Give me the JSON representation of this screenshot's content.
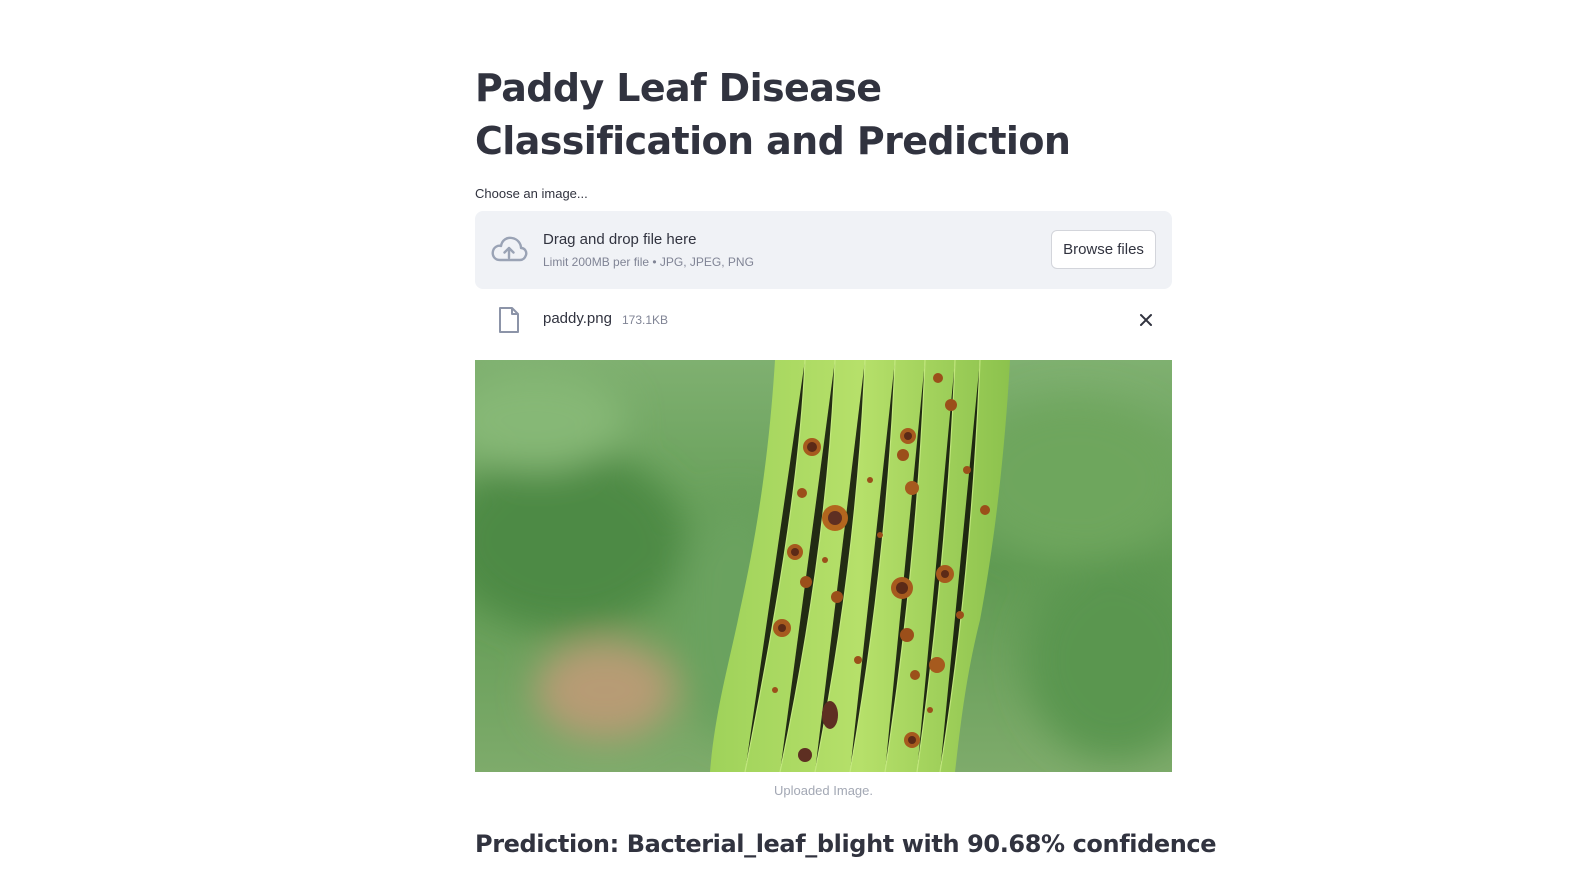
{
  "page": {
    "title": "Paddy Leaf Disease Classification and Prediction"
  },
  "uploader": {
    "label": "Choose an image...",
    "drop_text": "Drag and drop file here",
    "limit_text": "Limit 200MB per file • JPG, JPEG, PNG",
    "browse_label": "Browse files",
    "icon": "cloud-upload-icon"
  },
  "uploaded_file": {
    "name": "paddy.png",
    "size": "173.1KB",
    "icon": "file-icon"
  },
  "image": {
    "caption": "Uploaded Image."
  },
  "result": {
    "prediction": "Prediction: Bacterial_leaf_blight with 90.68% confidence"
  },
  "colors": {
    "text": "#31333f",
    "muted": "#808495",
    "dropzone_bg": "#f0f2f6"
  }
}
